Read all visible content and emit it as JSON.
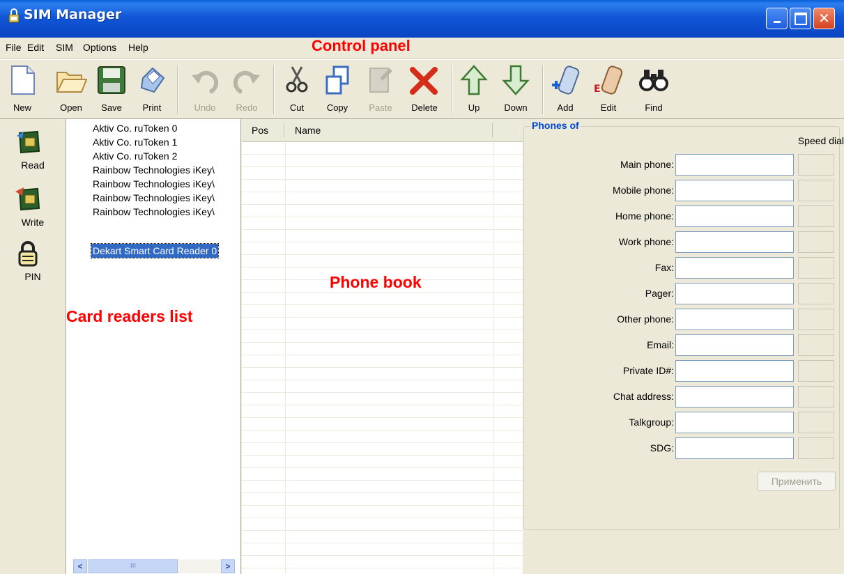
{
  "window": {
    "title": "SIM Manager"
  },
  "menu": [
    {
      "label": "File"
    },
    {
      "label": "Edit"
    },
    {
      "label": "SIM"
    },
    {
      "label": "Options"
    },
    {
      "label": "Help"
    }
  ],
  "annotations": {
    "control_panel": "Control panel",
    "card_readers": "Card readers list",
    "phone_book": "Phone book"
  },
  "toolbar": {
    "new": "New",
    "open": "Open",
    "save": "Save",
    "print": "Print",
    "undo": "Undo",
    "redo": "Redo",
    "cut": "Cut",
    "copy": "Copy",
    "paste": "Paste",
    "delete": "Delete",
    "up": "Up",
    "down": "Down",
    "add": "Add",
    "edit": "Edit",
    "find": "Find"
  },
  "sidebar": {
    "read": "Read",
    "write": "Write",
    "pin": "PIN"
  },
  "readers": [
    "Aktiv Co. ruToken 0",
    "Aktiv Co. ruToken 1",
    "Aktiv Co. ruToken 2",
    "Rainbow Technologies iKey\\",
    "Rainbow Technologies iKey\\",
    "Rainbow Technologies iKey\\",
    "Rainbow Technologies iKey\\",
    "Dekart Smart Card Reader 0"
  ],
  "selected_reader_index": 7,
  "phonebook": {
    "col_pos": "Pos",
    "col_name": "Name"
  },
  "phones": {
    "title": "Phones of",
    "speed_dial": "Speed dial",
    "fields": [
      {
        "label": "Main phone:",
        "value": ""
      },
      {
        "label": "Mobile phone:",
        "value": ""
      },
      {
        "label": "Home phone:",
        "value": ""
      },
      {
        "label": "Work phone:",
        "value": ""
      },
      {
        "label": "Fax:",
        "value": ""
      },
      {
        "label": "Pager:",
        "value": ""
      },
      {
        "label": "Other phone:",
        "value": ""
      },
      {
        "label": "Email:",
        "value": ""
      },
      {
        "label": "Private ID#:",
        "value": ""
      },
      {
        "label": "Chat address:",
        "value": ""
      },
      {
        "label": "Talkgroup:",
        "value": ""
      },
      {
        "label": "SDG:",
        "value": ""
      }
    ],
    "apply": "Применить"
  },
  "colors": {
    "selection": "#316ac5",
    "annotation": "#ff0000",
    "title_bar": "#0a44c4",
    "group_title": "#0046d5"
  }
}
